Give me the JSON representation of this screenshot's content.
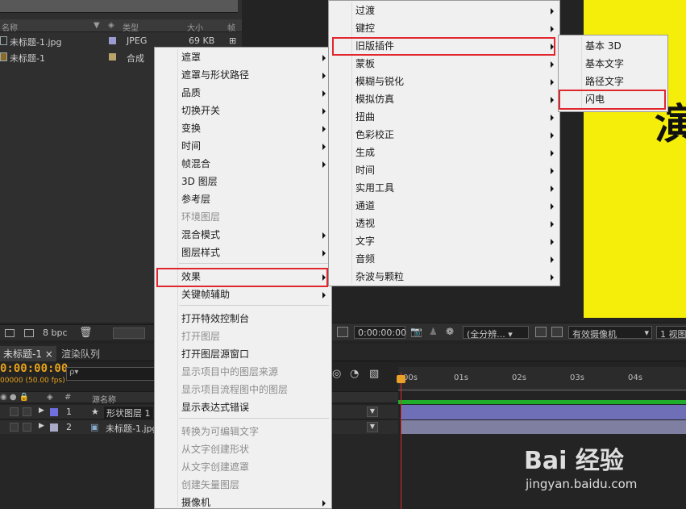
{
  "project": {
    "col_name": "名称",
    "col_type": "类型",
    "col_size": "大小",
    "col_more": "帧",
    "items": [
      {
        "name": "未标题-1.jpg",
        "type": "JPEG",
        "size": "69 KB",
        "swatch": "#9b9bd0"
      },
      {
        "name": "未标题-1",
        "type": "合成",
        "size": "",
        "swatch": "#b9a36a"
      }
    ],
    "bpc": "8 bpc"
  },
  "viewer": {
    "timecode": "0:00:00:00",
    "resolution": "(全分辨...",
    "camera": "有效摄像机",
    "views": "1 视图",
    "glyph": "演"
  },
  "timeline": {
    "tab_comp": "未标题-1",
    "tab_close": "×",
    "tab_render": "渲染队列",
    "timecode": "0:00:00:00",
    "fps": "00000 (50.00 fps)",
    "search_placeholder": "ρ▾",
    "col_num": "#",
    "col_source": "源名称",
    "layers": [
      {
        "num": "1",
        "name": "形状图层 1",
        "color": "#6f6fe0"
      },
      {
        "num": "2",
        "name": "未标题-1.jpg",
        "color": "#a9a9c8"
      }
    ],
    "ticks": [
      "00s",
      "01s",
      "02s",
      "03s",
      "04s"
    ]
  },
  "menu_main": {
    "items": [
      {
        "label": "遮罩",
        "arrow": true,
        "disabled": false
      },
      {
        "label": "遮罩与形状路径",
        "arrow": true,
        "disabled": false
      },
      {
        "label": "品质",
        "arrow": true,
        "disabled": false
      },
      {
        "label": "切换开关",
        "arrow": true,
        "disabled": false
      },
      {
        "label": "变换",
        "arrow": true,
        "disabled": false
      },
      {
        "label": "时间",
        "arrow": true,
        "disabled": false
      },
      {
        "label": "帧混合",
        "arrow": true,
        "disabled": false
      },
      {
        "label": "3D 图层",
        "arrow": false,
        "disabled": false
      },
      {
        "label": "参考层",
        "arrow": false,
        "disabled": false
      },
      {
        "label": "环境图层",
        "arrow": false,
        "disabled": true
      },
      {
        "label": "混合模式",
        "arrow": true,
        "disabled": false
      },
      {
        "label": "图层样式",
        "arrow": true,
        "disabled": false
      },
      {
        "label": "效果",
        "arrow": true,
        "disabled": false
      },
      {
        "label": "关键帧辅助",
        "arrow": true,
        "disabled": false
      },
      {
        "label": "打开特效控制台",
        "arrow": false,
        "disabled": false
      },
      {
        "label": "打开图层",
        "arrow": false,
        "disabled": true
      },
      {
        "label": "打开图层源窗口",
        "arrow": false,
        "disabled": false
      },
      {
        "label": "显示项目中的图层来源",
        "arrow": false,
        "disabled": true
      },
      {
        "label": "显示项目流程图中的图层",
        "arrow": false,
        "disabled": true
      },
      {
        "label": "显示表达式错误",
        "arrow": false,
        "disabled": false
      },
      {
        "label": "转换为可编辑文字",
        "arrow": false,
        "disabled": true
      },
      {
        "label": "从文字创建形状",
        "arrow": false,
        "disabled": true
      },
      {
        "label": "从文字创建遮罩",
        "arrow": false,
        "disabled": true
      },
      {
        "label": "创建矢量图层",
        "arrow": false,
        "disabled": true
      },
      {
        "label": "摄像机",
        "arrow": true,
        "disabled": false
      }
    ]
  },
  "menu_effects": {
    "items": [
      {
        "label": "过渡",
        "arrow": true
      },
      {
        "label": "键控",
        "arrow": true
      },
      {
        "label": "旧版插件",
        "arrow": true
      },
      {
        "label": "蒙板",
        "arrow": true
      },
      {
        "label": "模糊与锐化",
        "arrow": true
      },
      {
        "label": "模拟仿真",
        "arrow": true
      },
      {
        "label": "扭曲",
        "arrow": true
      },
      {
        "label": "色彩校正",
        "arrow": true
      },
      {
        "label": "生成",
        "arrow": true
      },
      {
        "label": "时间",
        "arrow": true
      },
      {
        "label": "实用工具",
        "arrow": true
      },
      {
        "label": "通道",
        "arrow": true
      },
      {
        "label": "透视",
        "arrow": true
      },
      {
        "label": "文字",
        "arrow": true
      },
      {
        "label": "音频",
        "arrow": true
      },
      {
        "label": "杂波与颗粒",
        "arrow": true
      }
    ]
  },
  "menu_legacy": {
    "items": [
      {
        "label": "基本 3D"
      },
      {
        "label": "基本文字"
      },
      {
        "label": "路径文字"
      },
      {
        "label": "闪电"
      }
    ]
  },
  "watermark": {
    "logo": "Bai 经验",
    "url": "jingyan.baidu.com"
  }
}
